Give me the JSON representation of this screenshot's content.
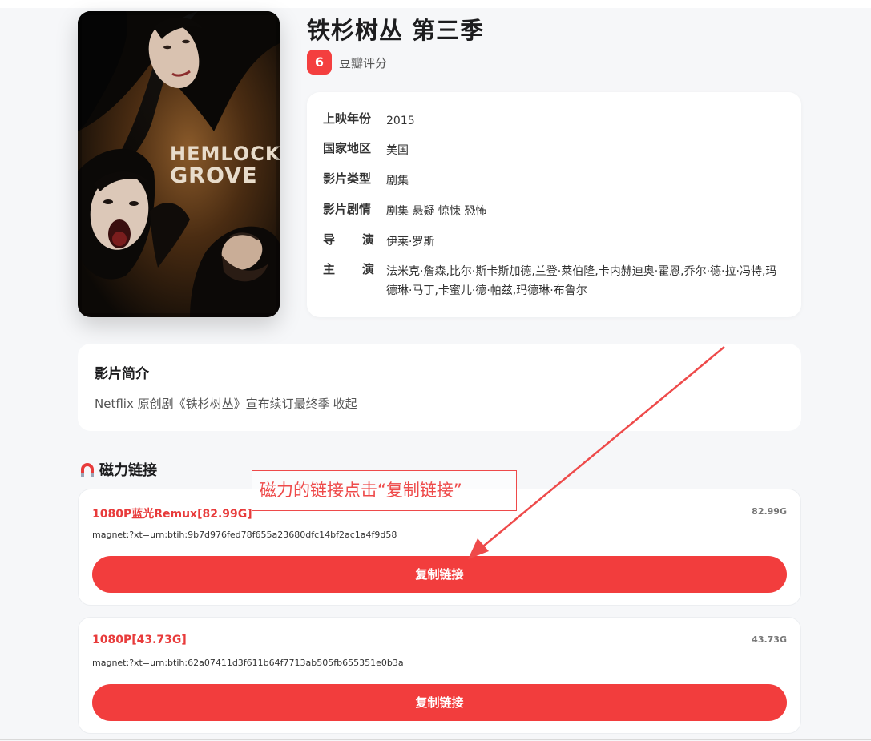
{
  "movie": {
    "title": "铁杉树丛 第三季",
    "poster_text_line1": "HEMLOCK",
    "poster_text_line2": "GROVE",
    "score": "6",
    "score_label": "豆瓣评分"
  },
  "info": {
    "rows": [
      {
        "label": "上映年份",
        "value": "2015"
      },
      {
        "label": "国家地区",
        "value": "美国"
      },
      {
        "label": "影片类型",
        "value": "剧集"
      },
      {
        "label": "影片剧情",
        "value": "剧集 悬疑 惊悚 恐怖"
      },
      {
        "label_a": "导",
        "label_b": "演",
        "value": "伊莱·罗斯"
      },
      {
        "label_a": "主",
        "label_b": "演",
        "value": "法米克·詹森,比尔·斯卡斯加德,兰登·莱伯隆,卡内赫迪奥·霍恩,乔尔·德·拉·冯特,玛德琳·马丁,卡蜜儿·德·帕兹,玛德琳·布鲁尔"
      }
    ]
  },
  "intro": {
    "title": "影片简介",
    "text": "Netflix 原创剧《铁杉树丛》宣布续订最终季",
    "toggle": "收起"
  },
  "magnet_section": {
    "title": "磁力链接",
    "icon": "magnet-icon",
    "links": [
      {
        "name": "1080P蓝光Remux[82.99G]",
        "size": "82.99G",
        "hash": "magnet:?xt=urn:btih:9b7d976fed78f655a23680dfc14bf2ac1a4f9d58",
        "button": "复制链接"
      },
      {
        "name": "1080P[43.73G]",
        "size": "43.73G",
        "hash": "magnet:?xt=urn:btih:62a07411d3f611b64f7713ab505fb655351e0b3a",
        "button": "复制链接"
      }
    ]
  },
  "annotation": {
    "callout": "磁力的链接点击“复制链接”"
  },
  "colors": {
    "accent": "#f23d3d",
    "link_name": "#e83b3b",
    "background": "#f6f7f9"
  }
}
